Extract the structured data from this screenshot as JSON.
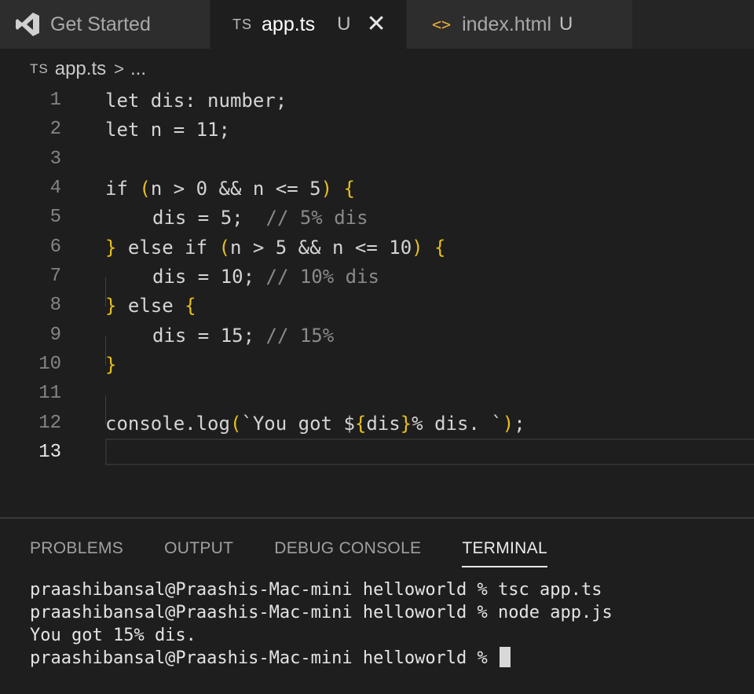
{
  "tabs": [
    {
      "label": "Get Started",
      "icon": "vscode-logo-icon",
      "active": false
    },
    {
      "badge": "TS",
      "label": "app.ts",
      "status": "U",
      "close": "✕",
      "active": true
    },
    {
      "badge": "<>",
      "label": "index.html",
      "status": "U",
      "active": false
    }
  ],
  "breadcrumb": {
    "badge": "TS",
    "file": "app.ts",
    "separator": ">",
    "rest": "..."
  },
  "editor": {
    "lines": [
      {
        "num": "1",
        "text": "let dis: number;"
      },
      {
        "num": "2",
        "text": "let n = 11;"
      },
      {
        "num": "3",
        "text": ""
      },
      {
        "num": "4",
        "text": "if (n > 0 && n <= 5) {"
      },
      {
        "num": "5",
        "text": "dis = 5;  // 5% dis"
      },
      {
        "num": "6",
        "text": "} else if (n > 5 && n <= 10) {"
      },
      {
        "num": "7",
        "text": "dis = 10; // 10% dis"
      },
      {
        "num": "8",
        "text": "} else {"
      },
      {
        "num": "9",
        "text": "dis = 15; // 15%"
      },
      {
        "num": "10",
        "text": "}"
      },
      {
        "num": "11",
        "text": ""
      },
      {
        "num": "12",
        "text": "console.log(`You got ${dis}% dis. `);"
      },
      {
        "num": "13",
        "text": ""
      }
    ],
    "current_line": "13"
  },
  "panel": {
    "tabs": [
      "PROBLEMS",
      "OUTPUT",
      "DEBUG CONSOLE",
      "TERMINAL"
    ],
    "active_tab": "TERMINAL",
    "terminal_lines": [
      "praashibansal@Praashis-Mac-mini helloworld % tsc app.ts",
      "praashibansal@Praashis-Mac-mini helloworld % node app.js",
      "You got 15% dis.",
      "praashibansal@Praashis-Mac-mini helloworld % "
    ]
  },
  "colors": {
    "background": "#1e1e1e",
    "bracket": "#e7c01d",
    "comment": "#8a8a8a",
    "html_icon": "#e8ab3c"
  }
}
